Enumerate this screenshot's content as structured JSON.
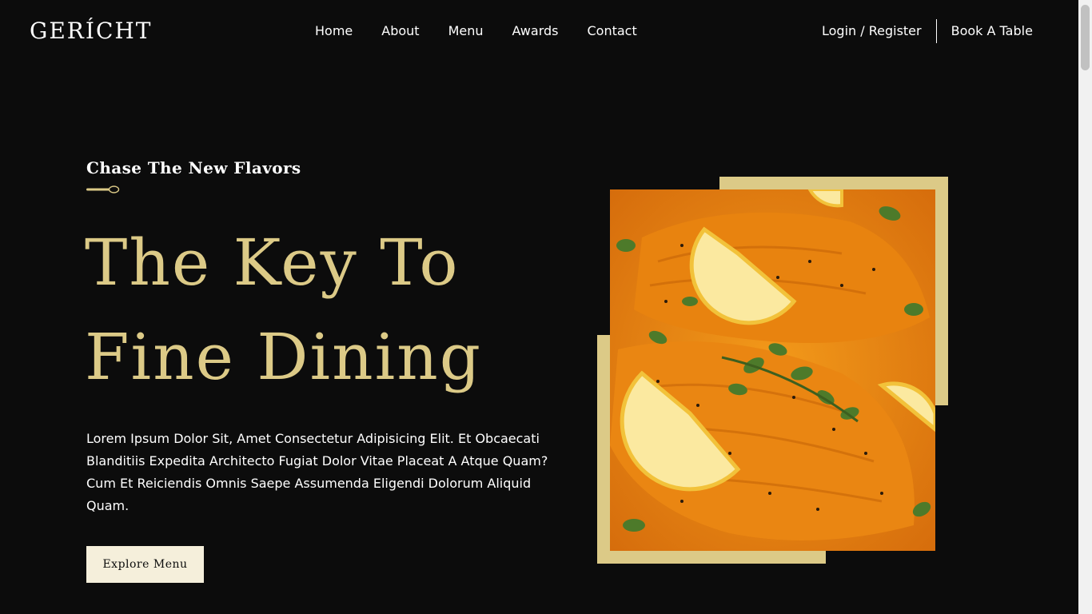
{
  "nav": {
    "logo": "GERÍCHT",
    "links": [
      "Home",
      "About",
      "Menu",
      "Awards",
      "Contact"
    ],
    "login": "Login / Register",
    "book": "Book A Table"
  },
  "hero": {
    "subtitle": "Chase The New Flavors",
    "headline_line1": "The Key To",
    "headline_line2": "Fine Dining",
    "description": "Lorem Ipsum Dolor Sit, Amet Consectetur Adipisicing Elit. Et Obcaecati Blanditiis Expedita Architecto Fugiat Dolor Vitae Placeat A Atque Quam? Cum Et Reiciendis Omnis Saepe Assumenda Eligendi Dolorum Aliquid Quam.",
    "button": "Explore Menu"
  },
  "colors": {
    "background": "#0c0c0c",
    "accent_gold": "#dcca87",
    "button_bg": "#f5efdb",
    "text": "#ffffff"
  },
  "icons": [
    "spoon-icon"
  ]
}
